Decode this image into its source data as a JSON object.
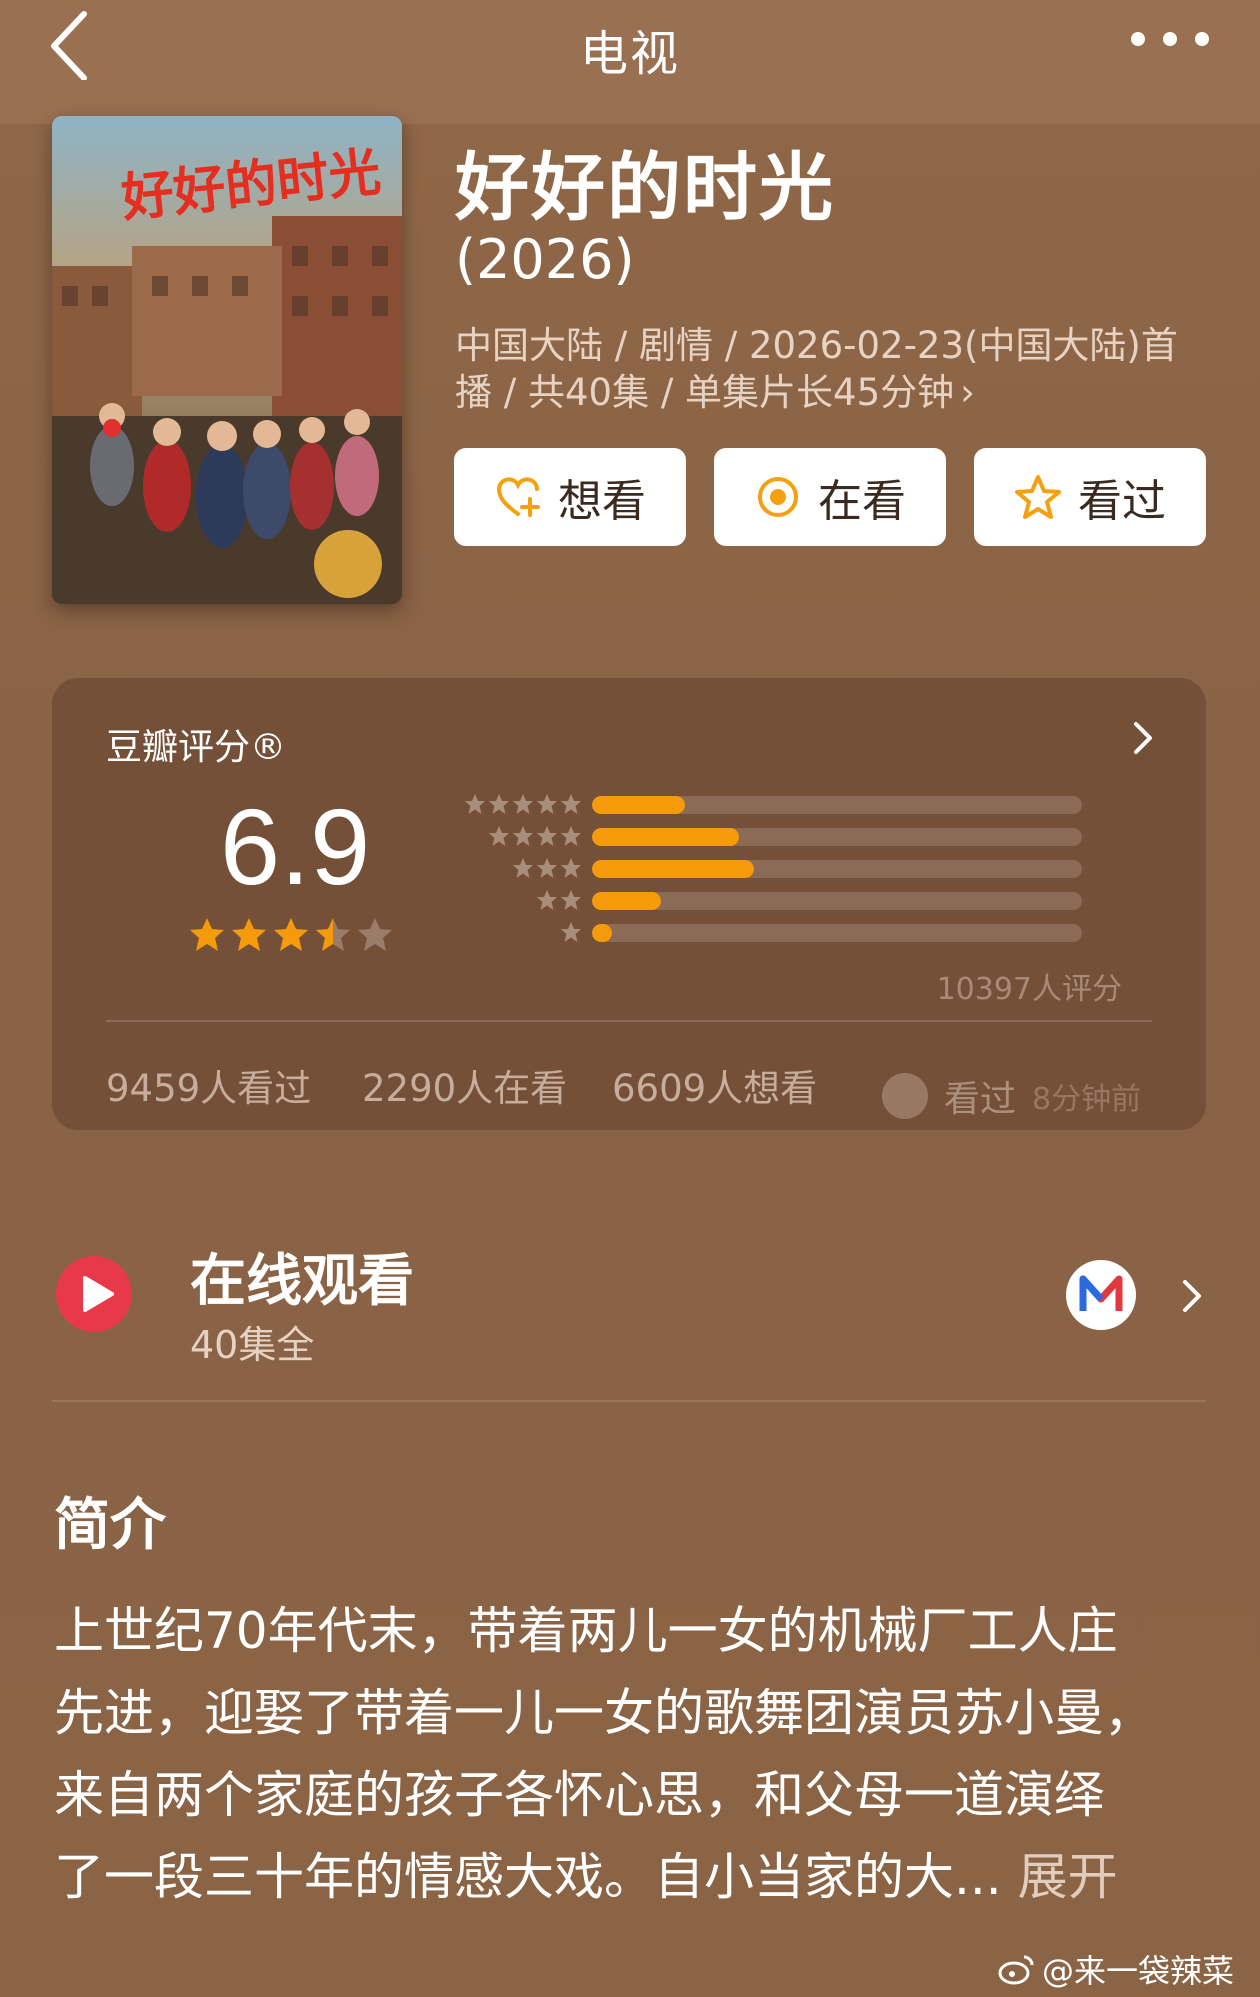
{
  "header": {
    "title": "电视"
  },
  "movie": {
    "title": "好好的时光",
    "year": "(2026)",
    "meta_line1": "中国大陆 / 剧情 / 2026-02-23(中国大陆)首",
    "meta_line2": "播 / 共40集 / 单集片长45分钟",
    "poster_text": "好好的时光"
  },
  "actions": [
    {
      "label": "想看",
      "icon": "heart-plus-icon"
    },
    {
      "label": "在看",
      "icon": "target-icon"
    },
    {
      "label": "看过",
      "icon": "star-outline-icon"
    }
  ],
  "rating": {
    "label": "豆瓣评分®",
    "score": "6.9",
    "stars": 3.5,
    "distribution": [
      {
        "stars": 5,
        "fraction": 0.19
      },
      {
        "stars": 4,
        "fraction": 0.3
      },
      {
        "stars": 3,
        "fraction": 0.33
      },
      {
        "stars": 2,
        "fraction": 0.14
      },
      {
        "stars": 1,
        "fraction": 0.04
      }
    ],
    "count_text": "10397人评分",
    "stats": {
      "watched": "9459人看过",
      "watching": "2290人在看",
      "want": "6609人想看"
    },
    "friend": {
      "status": "看过",
      "time": "8分钟前"
    },
    "accent_color": "#f59a0b"
  },
  "online": {
    "title": "在线观看",
    "subtitle": "40集全"
  },
  "synopsis": {
    "heading": "简介",
    "lines": [
      "上世纪70年代末，带着两儿一女的机械厂工人庄",
      "先进，迎娶了带着一儿一女的歌舞团演员苏小曼，",
      "来自两个家庭的孩子各怀心思，和父母一道演绎",
      "了一段三十年的情感大戏。自小当家的大..."
    ],
    "expand": " 展开"
  },
  "watermark": "@来一袋辣菜"
}
